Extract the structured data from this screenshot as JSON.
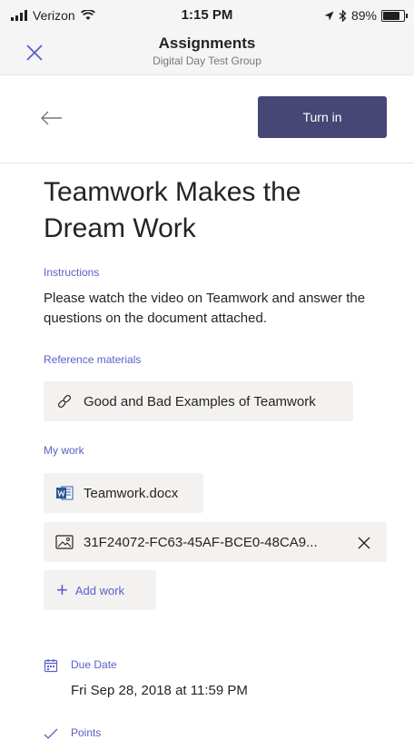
{
  "status_bar": {
    "carrier": "Verizon",
    "time": "1:15 PM",
    "battery": "89%",
    "battery_level": 0.89
  },
  "header": {
    "title": "Assignments",
    "subtitle": "Digital Day Test Group"
  },
  "actions": {
    "turn_in_label": "Turn in"
  },
  "assignment": {
    "title": "Teamwork Makes the Dream Work",
    "instructions_label": "Instructions",
    "instructions_text": "Please watch the video on Teamwork and answer the questions on the document attached.",
    "reference_label": "Reference materials",
    "reference_items": [
      {
        "label": "Good and Bad Examples of Teamwork",
        "icon": "link-icon"
      }
    ],
    "my_work_label": "My work",
    "my_work_items": [
      {
        "label": "Teamwork.docx",
        "icon": "word-doc-icon"
      },
      {
        "label": "31F24072-FC63-45AF-BCE0-48CA9...",
        "icon": "image-icon"
      }
    ],
    "add_work_label": "Add work",
    "due_label": "Due Date",
    "due_value": "Fri Sep 28, 2018 at 11:59 PM",
    "points_label": "Points"
  },
  "colors": {
    "accent": "#464775",
    "link": "#5b5fc7",
    "chip_bg": "#f3f2f1"
  }
}
